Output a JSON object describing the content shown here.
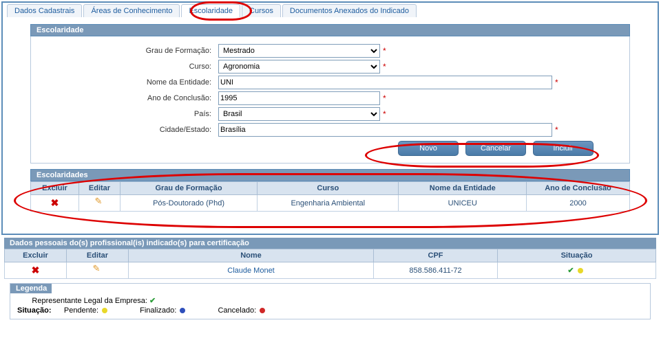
{
  "tabs": [
    {
      "label": "Dados Cadastrais"
    },
    {
      "label": "Áreas de Conhecimento"
    },
    {
      "label": "Escolaridade"
    },
    {
      "label": "Cursos"
    },
    {
      "label": "Documentos Anexados do Indicado"
    }
  ],
  "escolaridade_form": {
    "title": "Escolaridade",
    "grau_label": "Grau de Formação:",
    "grau_value": "Mestrado",
    "curso_label": "Curso:",
    "curso_value": "Agronomia",
    "entidade_label": "Nome da Entidade:",
    "entidade_value": "UNI",
    "ano_label": "Ano de Conclusão:",
    "ano_value": "1995",
    "pais_label": "País:",
    "pais_value": "Brasil",
    "cidade_label": "Cidade/Estado:",
    "cidade_value": "Brasília"
  },
  "buttons": {
    "novo": "Novo",
    "cancelar": "Cancelar",
    "incluir": "Incluir"
  },
  "escolaridades_table": {
    "title": "Escolaridades",
    "headers": {
      "excluir": "Excluir",
      "editar": "Editar",
      "grau": "Grau de Formação",
      "curso": "Curso",
      "entidade": "Nome da Entidade",
      "ano": "Ano de Conclusão"
    },
    "row": {
      "grau": "Pós-Doutorado (Phd)",
      "curso": "Engenharia Ambiental",
      "entidade": "UNICEU",
      "ano": "2000"
    }
  },
  "profissionais": {
    "title": "Dados pessoais do(s) profissional(is) indicado(s) para certificação",
    "headers": {
      "excluir": "Excluir",
      "editar": "Editar",
      "nome": "Nome",
      "cpf": "CPF",
      "situacao": "Situação"
    },
    "row": {
      "nome": "Claude Monet",
      "cpf": "858.586.411-72"
    }
  },
  "legenda": {
    "title": "Legenda",
    "rep_legal": "Representante Legal da Empresa:",
    "situacao_label": "Situação:",
    "pendente": "Pendente:",
    "finalizado": "Finalizado:",
    "cancelado": "Cancelado:"
  }
}
